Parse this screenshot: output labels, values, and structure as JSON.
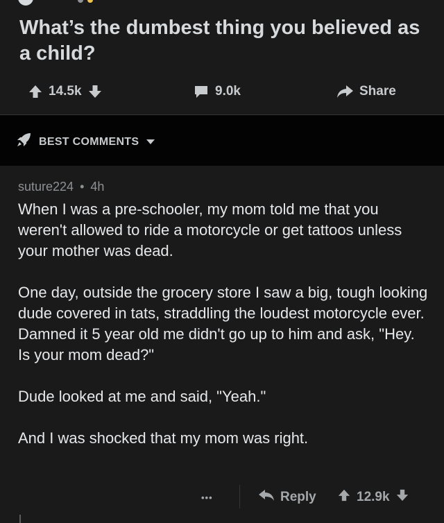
{
  "post": {
    "title": "What’s the dumbest thing you believed as a child?",
    "upvotes": "14.5k",
    "comments": "9.0k",
    "share_label": "Share"
  },
  "sort": {
    "label": "BEST COMMENTS"
  },
  "comment": {
    "author": "suture224",
    "separator": "•",
    "age": "4h",
    "paragraphs": [
      "When I was a pre-schooler, my mom told me that you weren't allowed to ride a motorcycle or get tattoos unless your mother was dead.",
      "One day, outside the grocery store I saw a big, tough looking dude covered in tats, straddling the loudest motorcycle ever. Damned it 5 year old me didn't go up to him and ask, \"Hey. Is your mom dead?\"",
      "Dude looked at me and said, \"Yeah.\"",
      "And I was shocked that my mom was right."
    ],
    "more_label": "•••",
    "reply_label": "Reply",
    "score": "12.9k"
  },
  "icons": {
    "upvote": "arrow-up-icon",
    "downvote": "arrow-down-icon",
    "comments": "comment-bubble-icon",
    "share": "share-arrow-icon",
    "sort": "rocket-icon",
    "dropdown": "caret-down-icon",
    "reply": "reply-arrow-icon",
    "more": "more-dots-icon"
  },
  "colors": {
    "background": "#1a1a1b",
    "sort_bar": "#030303",
    "text": "#d7dadc",
    "muted": "#8e9194"
  }
}
